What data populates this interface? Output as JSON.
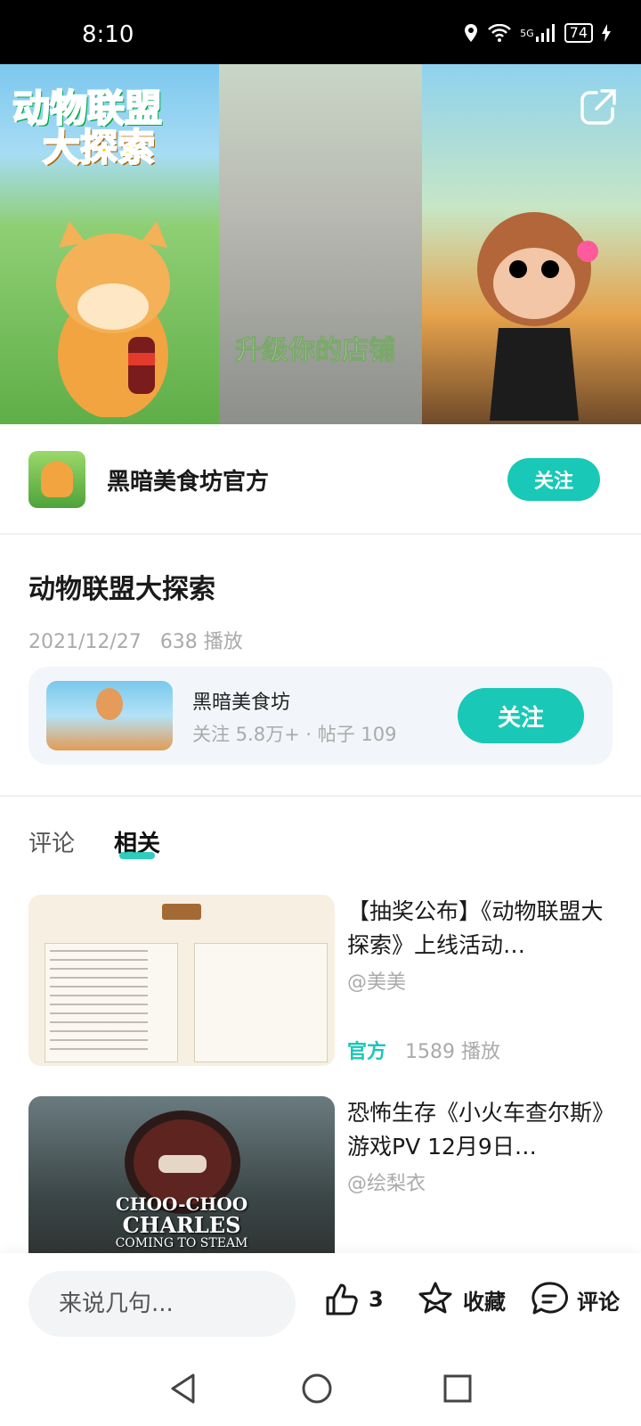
{
  "status_bar": {
    "time": "8:10",
    "battery": "74",
    "signal": "5G"
  },
  "hero": {
    "logo_line1": "动物联盟",
    "logo_line2": "大探索",
    "mid_caption": "升级你的店铺"
  },
  "channel": {
    "name": "黑暗美食坊官方",
    "follow_label": "关注"
  },
  "video": {
    "title": "动物联盟大探索",
    "date": "2021/12/27",
    "plays": "638 播放"
  },
  "game_card": {
    "name": "黑暗美食坊",
    "stats": "关注 5.8万+ · 帖子 109",
    "follow_label": "关注"
  },
  "tabs": [
    {
      "label": "评论",
      "active": false
    },
    {
      "label": "相关",
      "active": true
    }
  ],
  "related": [
    {
      "title": "【抽奖公布】《动物联盟大探索》上线活动…",
      "author": "@美美",
      "badge": "官方",
      "plays": "1589 播放"
    },
    {
      "title": "恐怖生存《小火车查尔斯》游戏PV 12月9日…",
      "author": "@绘梨衣",
      "thumb_text_line1": "CHOO-CHOO",
      "thumb_text_line2": "CHARLES",
      "thumb_text_line3": "COMING TO STEAM"
    }
  ],
  "bottom_bar": {
    "input_placeholder": "来说几句...",
    "like_count": "3",
    "favorite_label": "收藏",
    "comment_label": "评论"
  },
  "colors": {
    "accent": "#19c8b6",
    "muted": "#aaaaaa"
  },
  "icons": [
    "location-icon",
    "wifi-icon",
    "signal-icon",
    "battery-icon",
    "charging-icon",
    "share-icon",
    "thumbs-up-icon",
    "star-icon",
    "comment-icon",
    "back-icon",
    "home-icon",
    "recents-icon"
  ]
}
